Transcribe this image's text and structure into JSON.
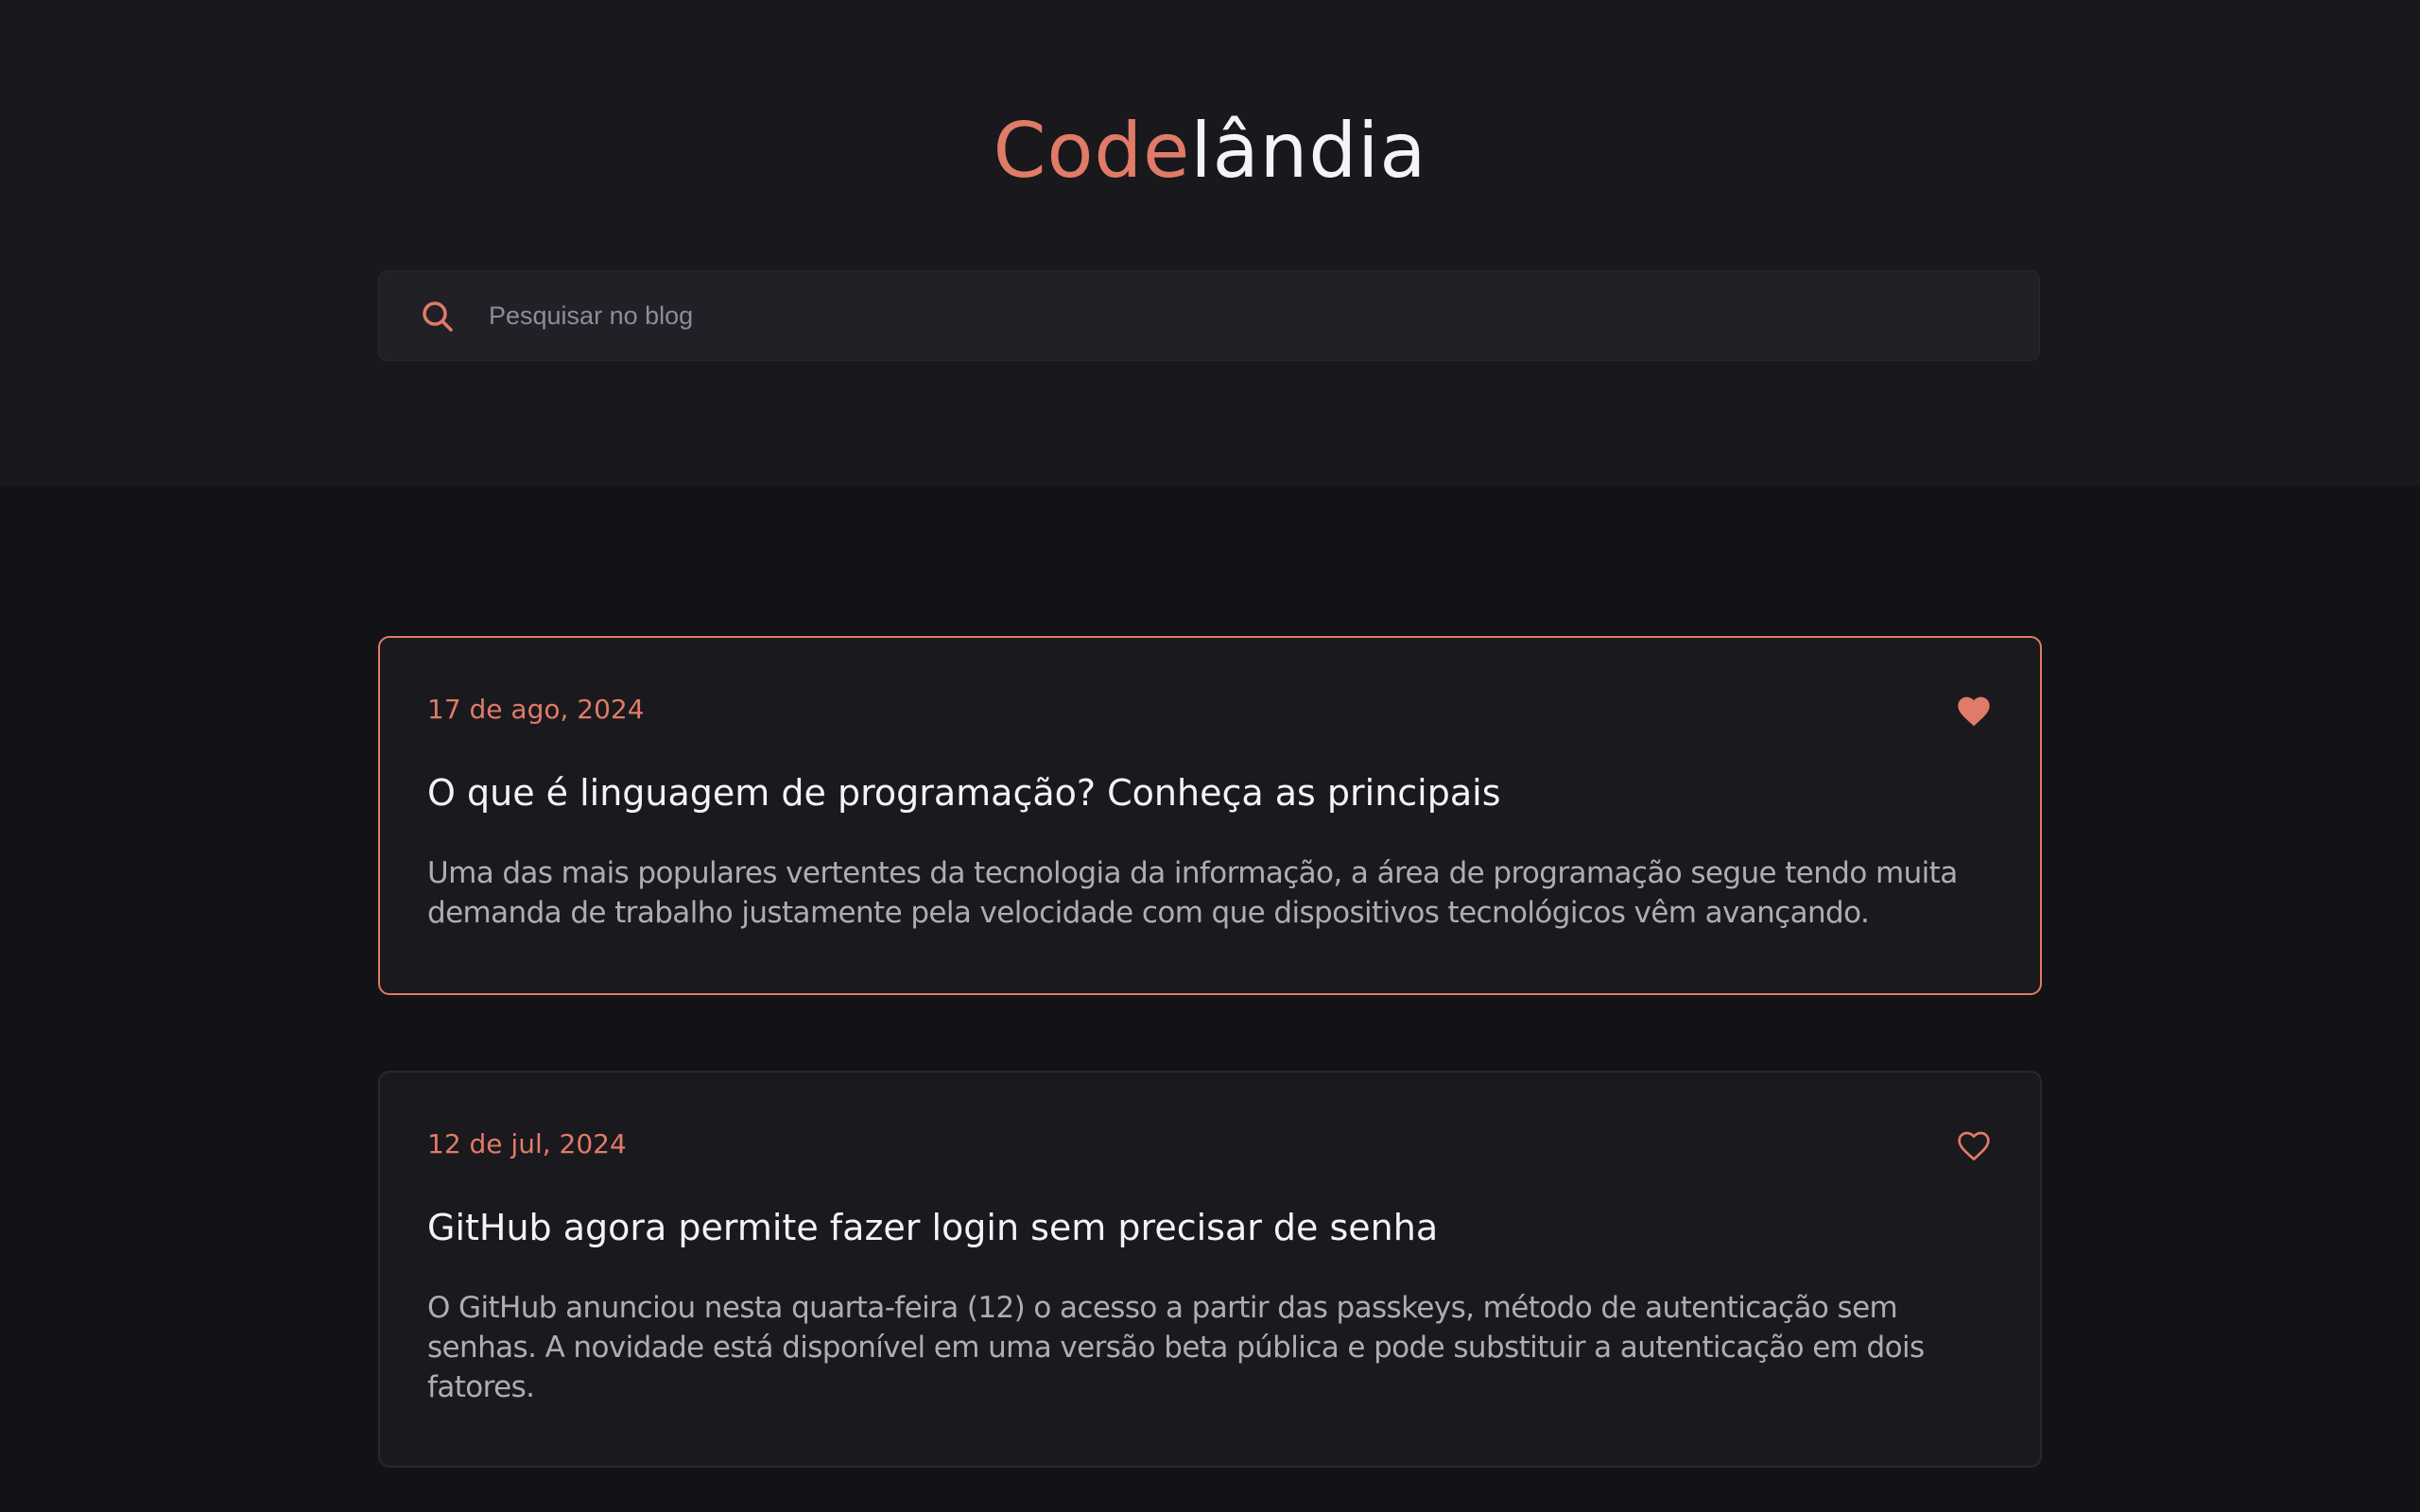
{
  "header": {
    "logo_accent": "Code",
    "logo_rest": "lândia",
    "accent_color": "#e07b67"
  },
  "search": {
    "placeholder": "Pesquisar no blog",
    "value": "",
    "icon": "search-icon"
  },
  "posts": [
    {
      "date": "17 de ago, 2024",
      "title": "O que é linguagem de programação? Conheça as principais",
      "excerpt": "Uma das mais populares vertentes da tecnologia da informação, a área de programação segue tendo muita demanda de trabalho justamente pela velocidade com que dispositivos tecnológicos vêm avançando.",
      "favorited": true,
      "icon": "heart-filled-icon"
    },
    {
      "date": "12 de jul, 2024",
      "title": "GitHub agora permite fazer login sem precisar de senha",
      "excerpt": "O GitHub anunciou nesta quarta-feira (12) o acesso a partir das passkeys, método de autenticação sem senhas. A novidade está disponível em uma versão beta pública e pode substituir a autenticação em dois fatores.",
      "favorited": false,
      "icon": "heart-outline-icon"
    }
  ]
}
